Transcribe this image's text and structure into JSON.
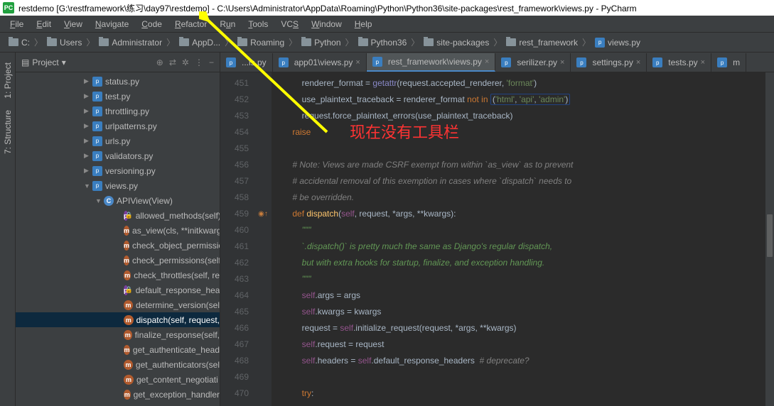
{
  "window": {
    "title": "restdemo [G:\\restframework\\练习\\day97\\restdemo] - C:\\Users\\Administrator\\AppData\\Roaming\\Python\\Python36\\site-packages\\rest_framework\\views.py - PyCharm"
  },
  "menu": {
    "file": "File",
    "edit": "Edit",
    "view": "View",
    "navigate": "Navigate",
    "code": "Code",
    "refactor": "Refactor",
    "run": "Run",
    "tools": "Tools",
    "vcs": "VCS",
    "window": "Window",
    "help": "Help"
  },
  "breadcrumb": {
    "drive": "C:",
    "items": [
      "Users",
      "Administrator",
      "AppD...",
      "Roaming",
      "Python",
      "Python36",
      "site-packages",
      "rest_framework"
    ],
    "file": "views.py"
  },
  "sidebar": {
    "project": "1: Project",
    "structure": "7: Structure"
  },
  "project": {
    "title": "Project",
    "dropdown": "▾",
    "tools": [
      "⊕",
      "⇄",
      "✲",
      "⋮",
      "−"
    ]
  },
  "tree": [
    {
      "depth": 1,
      "arrow": "▶",
      "icon": "py",
      "label": "status.py"
    },
    {
      "depth": 1,
      "arrow": "▶",
      "icon": "py",
      "label": "test.py"
    },
    {
      "depth": 1,
      "arrow": "▶",
      "icon": "py",
      "label": "throttling.py"
    },
    {
      "depth": 1,
      "arrow": "▶",
      "icon": "py",
      "label": "urlpatterns.py"
    },
    {
      "depth": 1,
      "arrow": "▶",
      "icon": "py",
      "label": "urls.py"
    },
    {
      "depth": 1,
      "arrow": "▶",
      "icon": "py",
      "label": "validators.py"
    },
    {
      "depth": 1,
      "arrow": "▶",
      "icon": "py",
      "label": "versioning.py"
    },
    {
      "depth": 1,
      "arrow": "▼",
      "icon": "py",
      "label": "views.py"
    },
    {
      "depth": 2,
      "arrow": "▼",
      "icon": "class",
      "label": "APIView(View)"
    },
    {
      "depth": 3,
      "icon": "p",
      "lock": true,
      "label": "allowed_methods(self)"
    },
    {
      "depth": 3,
      "icon": "m",
      "label": "as_view(cls, **initkwargs)"
    },
    {
      "depth": 3,
      "icon": "m",
      "label": "check_object_permissions"
    },
    {
      "depth": 3,
      "icon": "m",
      "label": "check_permissions(self,"
    },
    {
      "depth": 3,
      "icon": "m",
      "label": "check_throttles(self, re"
    },
    {
      "depth": 3,
      "icon": "p",
      "lock": true,
      "label": "default_response_hea"
    },
    {
      "depth": 3,
      "icon": "m",
      "label": "determine_version(sel"
    },
    {
      "depth": 3,
      "icon": "m",
      "label": "dispatch(self, request,",
      "selected": true
    },
    {
      "depth": 3,
      "icon": "m",
      "label": "finalize_response(self,"
    },
    {
      "depth": 3,
      "icon": "m",
      "label": "get_authenticate_head"
    },
    {
      "depth": 3,
      "icon": "m",
      "label": "get_authenticators(sel"
    },
    {
      "depth": 3,
      "icon": "m",
      "label": "get_content_negotiati"
    },
    {
      "depth": 3,
      "icon": "m",
      "label": "get_exception_handler"
    }
  ],
  "tabs": [
    {
      "label": "...ls.py",
      "active": false,
      "partial": true
    },
    {
      "label": "app01\\views.py",
      "active": false
    },
    {
      "label": "rest_framework\\views.py",
      "active": true
    },
    {
      "label": "serilizer.py",
      "active": false
    },
    {
      "label": "settings.py",
      "active": false
    },
    {
      "label": "tests.py",
      "active": false
    },
    {
      "label": "m",
      "active": false,
      "partial": true
    }
  ],
  "lineNumbers": [
    451,
    452,
    453,
    454,
    455,
    456,
    457,
    458,
    459,
    460,
    461,
    462,
    463,
    464,
    465,
    466,
    467,
    468,
    469,
    470
  ],
  "gutterMark": {
    "line": 459,
    "symbol": "◉↑"
  },
  "code": {
    "l451": "            renderer_format = getattr(request.accepted_renderer, 'format')",
    "l452": "            use_plaintext_traceback = renderer_format not in ('html', 'api', 'admin')",
    "l453": "            request.force_plaintext_errors(use_plaintext_traceback)",
    "l454": "        raise",
    "l455": "",
    "l456": "    # Note: Views are made CSRF exempt from within `as_view` as to prevent",
    "l457": "    # accidental removal of this exemption in cases where `dispatch` needs to",
    "l458": "    # be overridden.",
    "l459": "    def dispatch(self, request, *args, **kwargs):",
    "l460": "        \"\"\"",
    "l461": "        `.dispatch()` is pretty much the same as Django's regular dispatch,",
    "l462": "        but with extra hooks for startup, finalize, and exception handling.",
    "l463": "        \"\"\"",
    "l464": "        self.args = args",
    "l465": "        self.kwargs = kwargs",
    "l466": "        request = self.initialize_request(request, *args, **kwargs)",
    "l467": "        self.request = request",
    "l468": "        self.headers = self.default_response_headers  # deprecate?",
    "l469": "",
    "l470": "        try:"
  },
  "annotation": "现在没有工具栏"
}
